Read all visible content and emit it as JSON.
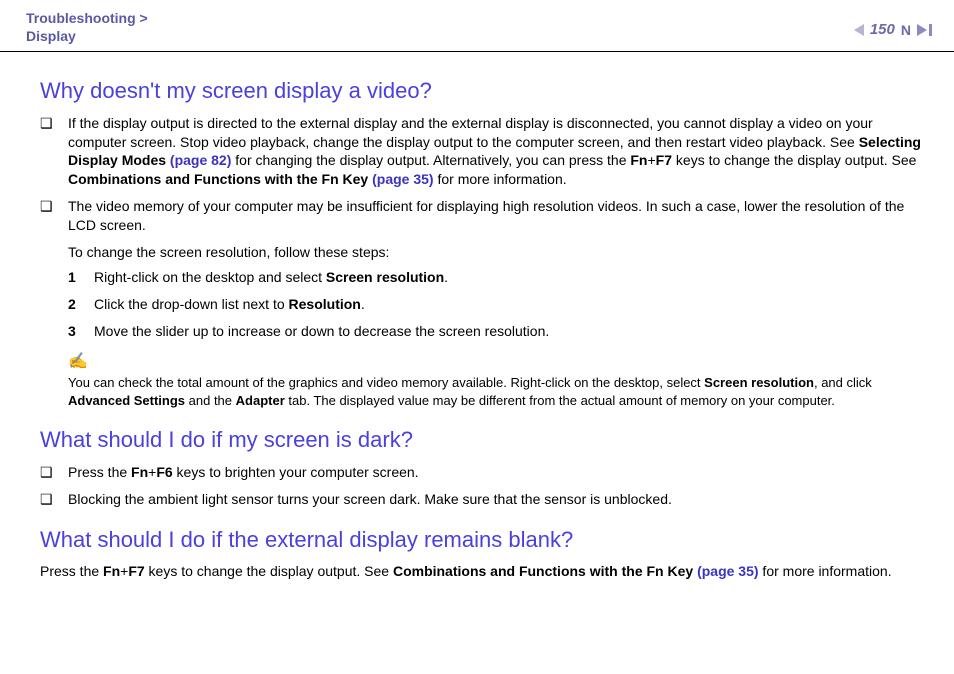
{
  "header": {
    "breadcrumb_top": "Troubleshooting >",
    "breadcrumb_bottom": "Display",
    "page_number": "150",
    "n_glyph": "N"
  },
  "s1": {
    "title": "Why doesn't my screen display a video?",
    "b1a": "If the display output is directed to the external display and the external display is disconnected, you cannot display a video on your computer screen. Stop video playback, change the display output to the computer screen, and then restart video playback. See ",
    "b1_link1": "Selecting Display Modes ",
    "b1_page1": "(page 82)",
    "b1b": " for changing the display output. Alternatively, you can press the ",
    "b1_fn": "Fn",
    "b1_plus": "+",
    "b1_f7": "F7",
    "b1c": " keys to change the display output. See ",
    "b1_link2": "Combinations and Functions with the Fn Key ",
    "b1_page2": "(page 35)",
    "b1d": " for more information.",
    "b2": "The video memory of your computer may be insufficient for displaying high resolution videos. In such a case, lower the resolution of the LCD screen.",
    "sub_intro": "To change the screen resolution, follow these steps:",
    "step1a": "Right-click on the desktop and select ",
    "step1b": "Screen resolution",
    "step1c": ".",
    "step2a": "Click the drop-down list next to ",
    "step2b": "Resolution",
    "step2c": ".",
    "step3": "Move the slider up to increase or down to decrease the screen resolution.",
    "note_icon": "✍",
    "note_a": "You can check the total amount of the graphics and video memory available. Right-click on the desktop, select ",
    "note_b": "Screen resolution",
    "note_c": ", and click ",
    "note_d": "Advanced Settings",
    "note_e": " and the ",
    "note_f": "Adapter",
    "note_g": " tab. The displayed value may be different from the actual amount of memory on your computer."
  },
  "s2": {
    "title": "What should I do if my screen is dark?",
    "b1a": "Press the ",
    "b1_fn": "Fn",
    "b1_plus": "+",
    "b1_f6": "F6",
    "b1b": " keys to brighten your computer screen.",
    "b2": "Blocking the ambient light sensor turns your screen dark. Make sure that the sensor is unblocked."
  },
  "s3": {
    "title": "What should I do if the external display remains blank?",
    "pa": "Press the ",
    "p_fn": "Fn",
    "p_plus": "+",
    "p_f7": "F7",
    "pb": " keys to change the display output. See ",
    "p_link": "Combinations and Functions with the Fn Key ",
    "p_page": "(page 35)",
    "pc": " for more information."
  },
  "glyphs": {
    "square": "❑"
  }
}
